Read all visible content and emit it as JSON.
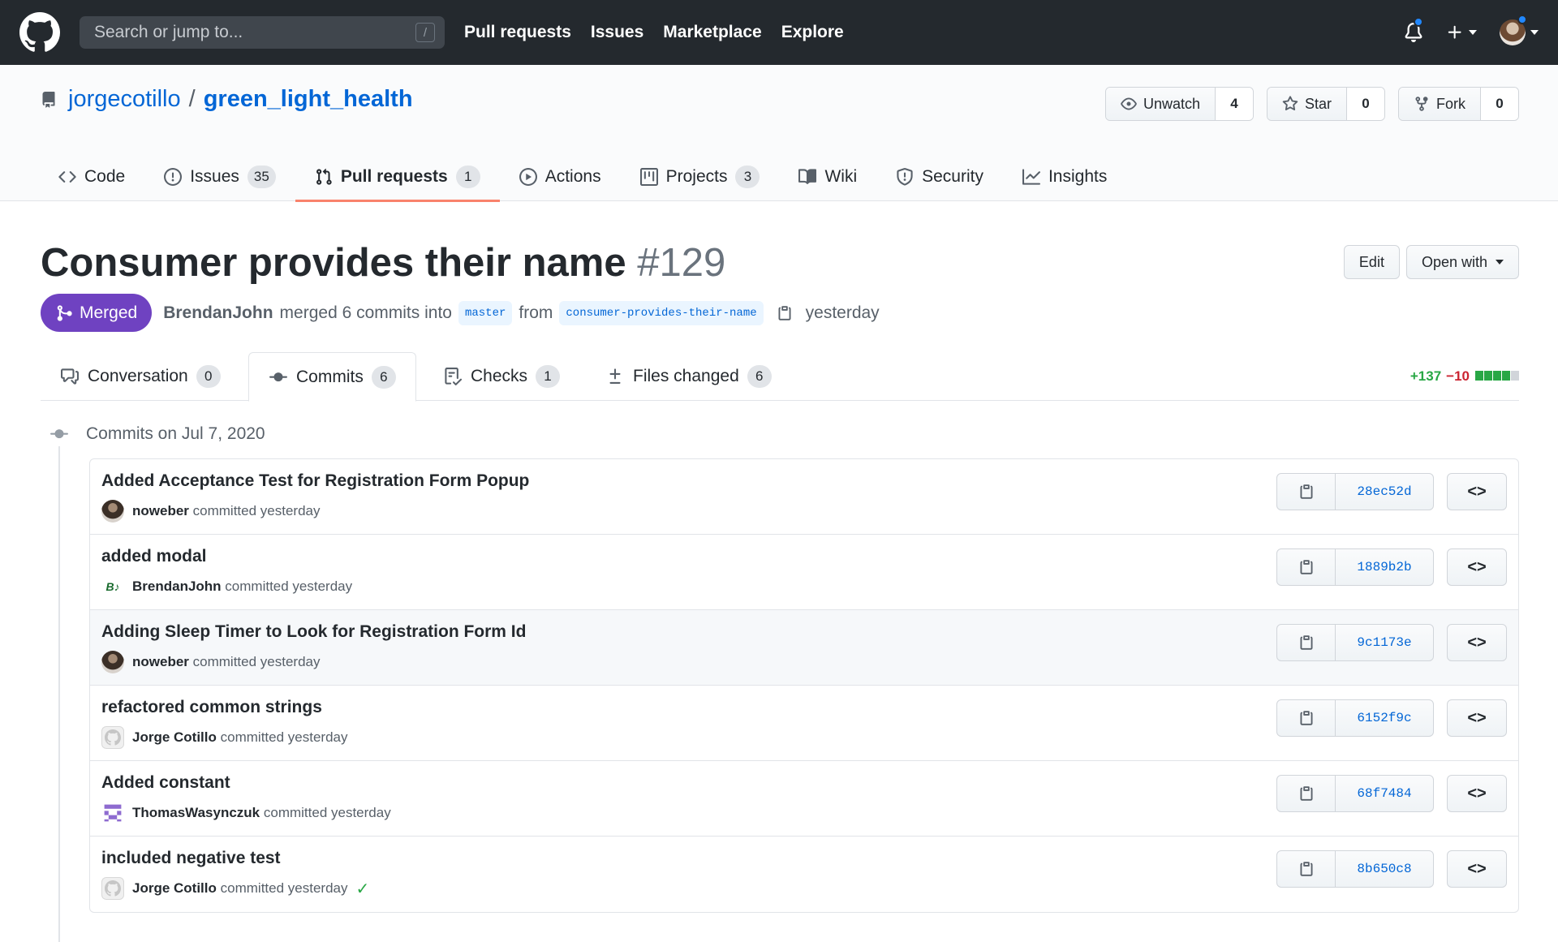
{
  "header": {
    "search_placeholder": "Search or jump to...",
    "search_shortcut": "/",
    "nav": [
      "Pull requests",
      "Issues",
      "Marketplace",
      "Explore"
    ]
  },
  "repo": {
    "owner": "jorgecotillo",
    "separator": "/",
    "name": "green_light_health",
    "watch_label": "Unwatch",
    "watch_count": "4",
    "star_label": "Star",
    "star_count": "0",
    "fork_label": "Fork",
    "fork_count": "0"
  },
  "reponav": {
    "code": "Code",
    "issues": "Issues",
    "issues_count": "35",
    "pulls": "Pull requests",
    "pulls_count": "1",
    "actions": "Actions",
    "projects": "Projects",
    "projects_count": "3",
    "wiki": "Wiki",
    "security": "Security",
    "insights": "Insights"
  },
  "pr": {
    "title": "Consumer provides their name",
    "number": "#129",
    "edit_label": "Edit",
    "open_with_label": "Open with",
    "state": "Merged",
    "author": "BrendanJohn",
    "merge_text": "merged 6 commits into",
    "base_branch": "master",
    "from_text": "from",
    "head_branch": "consumer-provides-their-name",
    "time": "yesterday"
  },
  "tabs": {
    "conversation": "Conversation",
    "conversation_count": "0",
    "commits": "Commits",
    "commits_count": "6",
    "checks": "Checks",
    "checks_count": "1",
    "files": "Files changed",
    "files_count": "6"
  },
  "diffstat": {
    "additions": "+137",
    "deletions": "−10",
    "blocks": [
      "green",
      "green",
      "green",
      "green",
      "gray"
    ]
  },
  "commits_date": "Commits on Jul 7, 2020",
  "commits": [
    {
      "title": "Added Acceptance Test for Registration Form Popup",
      "author": "noweber",
      "action": "committed yesterday",
      "sha": "28ec52d",
      "avatar": "photo",
      "highlight": false,
      "check": false
    },
    {
      "title": "added modal",
      "author": "BrendanJohn",
      "action": "committed yesterday",
      "sha": "1889b2b",
      "avatar": "bj",
      "highlight": false,
      "check": false
    },
    {
      "title": "Adding Sleep Timer to Look for Registration Form Id",
      "author": "noweber",
      "action": "committed yesterday",
      "sha": "9c1173e",
      "avatar": "photo",
      "highlight": true,
      "check": false
    },
    {
      "title": "refactored common strings",
      "author": "Jorge Cotillo",
      "action": "committed yesterday",
      "sha": "6152f9c",
      "avatar": "gh",
      "highlight": false,
      "check": false
    },
    {
      "title": "Added constant",
      "author": "ThomasWasynczuk",
      "action": "committed yesterday",
      "sha": "68f7484",
      "avatar": "tw",
      "highlight": false,
      "check": false
    },
    {
      "title": "included negative test",
      "author": "Jorge Cotillo",
      "action": "committed yesterday",
      "sha": "8b650c8",
      "avatar": "gh",
      "highlight": false,
      "check": true
    }
  ],
  "colors": {
    "header_bg": "#24292e",
    "link": "#0366d6",
    "merged": "#6f42c1",
    "addition": "#28a745",
    "deletion": "#cb2431",
    "tab_underline": "#f9826c"
  }
}
